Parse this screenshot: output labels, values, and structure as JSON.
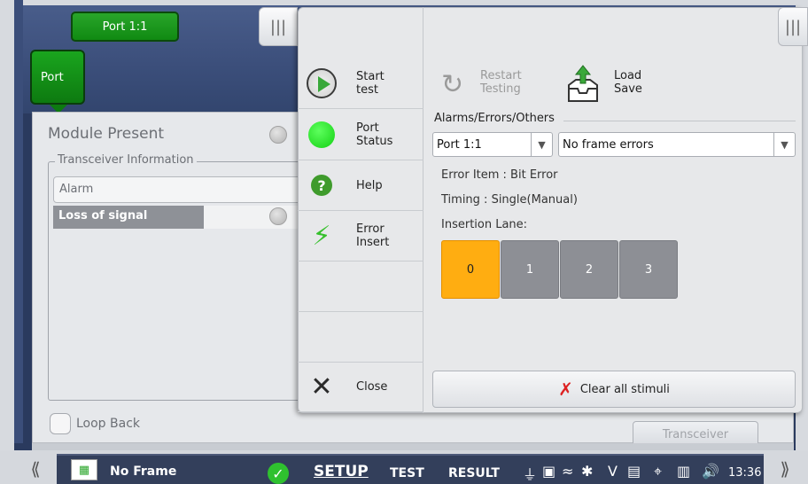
{
  "top": {
    "port_tab_label": "Port 1:1",
    "port_button_label": "Port"
  },
  "left_panel": {
    "module_present": "Module Present",
    "transceiver_legend": "Transceiver Information",
    "alarm_label": "Alarm",
    "loss_of_signal": "Loss of signal",
    "loop_back": "Loop Back",
    "transceiver_tab": "Transceiver"
  },
  "menu": {
    "start_test": "Start\ntest",
    "port_status": "Port\nStatus",
    "help": "Help",
    "error_insert": "Error\nInsert",
    "close": "Close",
    "handle": "|||"
  },
  "actions": {
    "restart_testing": "Restart\nTesting",
    "load_save": "Load\nSave"
  },
  "alarms": {
    "section_title": "Alarms/Errors/Others",
    "port_select": "Port 1:1",
    "error_select": "No frame errors",
    "error_item": "Error Item : Bit Error",
    "timing": "Timing : Single(Manual)",
    "insertion_lane": "Insertion Lane:",
    "lanes": [
      "0",
      "1",
      "2",
      "3"
    ],
    "selected_lane": "0",
    "clear_all": "Clear all stimuli"
  },
  "status": {
    "frame": "No Frame",
    "setup": "SETUP",
    "test": "TEST",
    "result": "RESULT",
    "clock": "13:36",
    "chev_left": "⟪",
    "chev_right": "⟫"
  },
  "colors": {
    "green": "#1aa51e",
    "lane_selected": "#ffad11",
    "lane_unselected": "#8d8f95",
    "statusbar": "#333f5b"
  }
}
